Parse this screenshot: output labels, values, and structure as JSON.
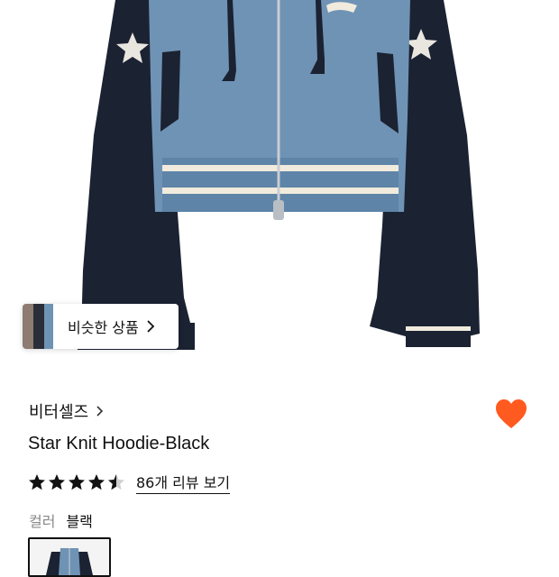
{
  "product": {
    "brand": "비터셀즈",
    "title": "Star Knit Hoodie-Black",
    "rating": 4.5,
    "review_link": "86개 리뷰 보기",
    "option_label": "컬러",
    "option_value": "블랙"
  },
  "similar_chip": {
    "label": "비슷한 상품"
  },
  "icons": {
    "heart": "heart-icon",
    "chevron": "chevron-right-icon",
    "star": "star-icon"
  },
  "colors": {
    "heart": "#FF5A1F",
    "sleeve": "#1B2232",
    "body_blue": "#6F93B5",
    "stripe": "#F1EBDD"
  }
}
